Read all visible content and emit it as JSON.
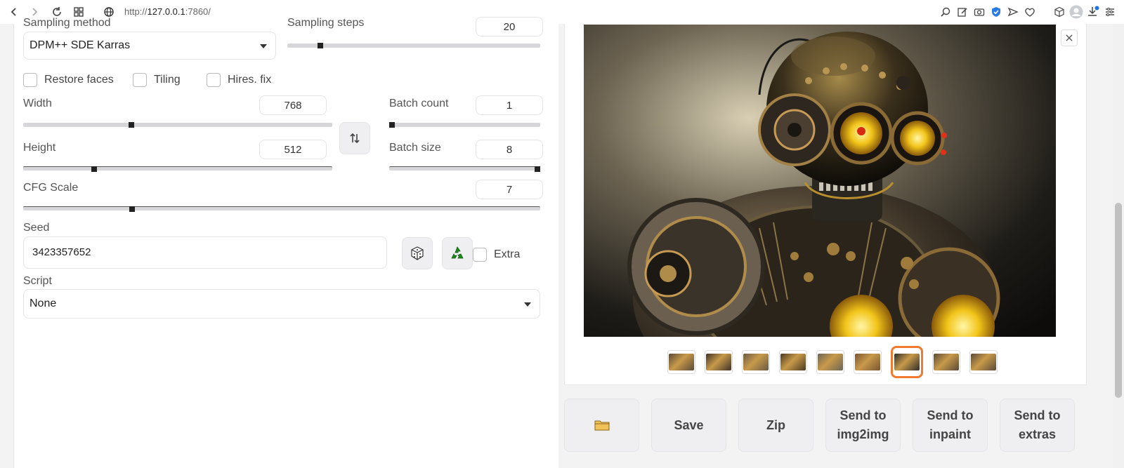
{
  "browser": {
    "url_prefix": "http://",
    "url_host": "127.0.0.1",
    "url_suffix": ":7860/"
  },
  "sampling": {
    "method_label": "Sampling method",
    "method_value": "DPM++ SDE Karras",
    "steps_label": "Sampling steps",
    "steps_value": "20",
    "steps_fraction": 0.13
  },
  "checkboxes": {
    "restore_faces": "Restore faces",
    "tiling": "Tiling",
    "hires_fix": "Hires. fix"
  },
  "width": {
    "label": "Width",
    "value": "768",
    "fraction": 0.35
  },
  "height": {
    "label": "Height",
    "value": "512",
    "fraction": 0.23
  },
  "batch_count": {
    "label": "Batch count",
    "value": "1",
    "fraction": 0.0
  },
  "batch_size": {
    "label": "Batch size",
    "value": "8",
    "fraction": 1.0
  },
  "cfg": {
    "label": "CFG Scale",
    "value": "7",
    "fraction": 0.21
  },
  "seed": {
    "label": "Seed",
    "value": "3423357652",
    "extra_label": "Extra"
  },
  "script": {
    "label": "Script",
    "value": "None"
  },
  "actions": {
    "save": "Save",
    "zip": "Zip",
    "send_img2img_1": "Send to",
    "send_img2img_2": "img2img",
    "send_inpaint_1": "Send to",
    "send_inpaint_2": "inpaint",
    "send_extras_1": "Send to",
    "send_extras_2": "extras"
  },
  "gallery": {
    "selected_index": 6,
    "thumbnail_colors": [
      "#5b4a38",
      "#3f3328",
      "#6a5a44",
      "#4a3a20",
      "#6b6657",
      "#7a5432",
      "#2f2d2b",
      "#5a4a36",
      "#594a3a"
    ]
  }
}
